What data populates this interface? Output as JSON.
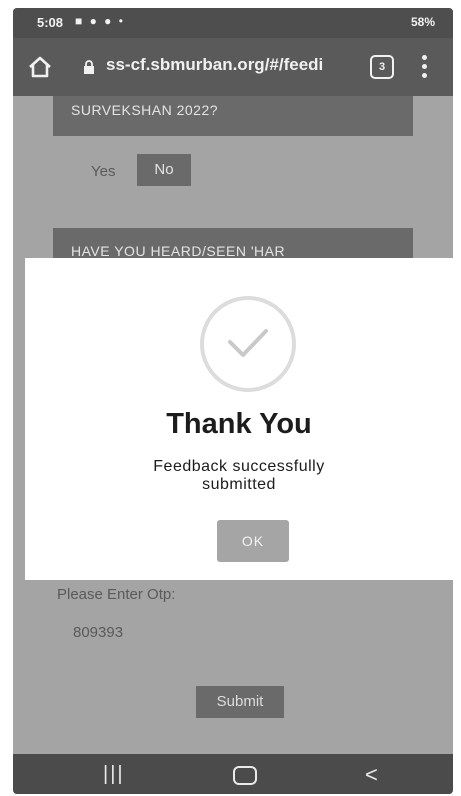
{
  "status_bar": {
    "time": "5:08",
    "notifications": "■ ● ● •",
    "signal_battery": "58%"
  },
  "browser": {
    "url": "ss-cf.sbmurban.org/#/feedi",
    "tab_count": "3"
  },
  "form": {
    "question1_header": "SURVEKSHAN 2022?",
    "yes_label": "Yes",
    "no_label": "No",
    "question2_header": "HAVE YOU HEARD/SEEN 'HAR",
    "otp_label": "Please Enter Otp:",
    "otp_value": "809393",
    "submit_label": "Submit"
  },
  "modal": {
    "title": "Thank You",
    "message": "Feedback successfully submitted",
    "ok_label": "OK",
    "icon": "checkmark-icon"
  },
  "nav_bar": {
    "recent_glyph": "|||",
    "back_glyph": "<"
  }
}
